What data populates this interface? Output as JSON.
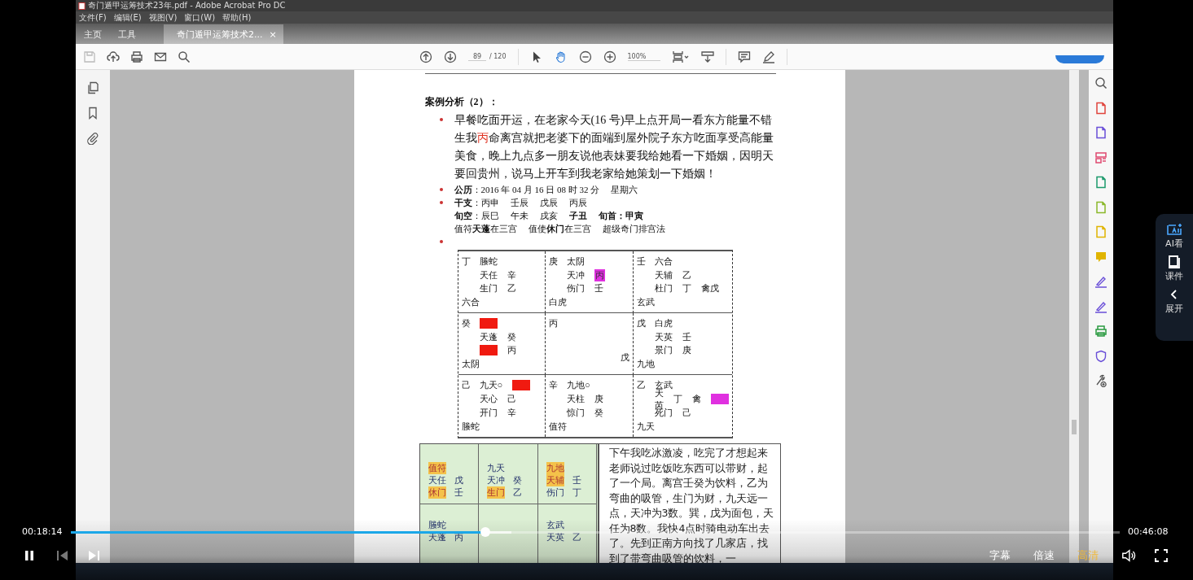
{
  "app": {
    "title": "奇门遁甲运筹技术23年.pdf - Adobe Acrobat Pro DC",
    "menus": [
      "文件(F)",
      "编辑(E)",
      "视图(V)",
      "窗口(W)",
      "帮助(H)"
    ],
    "tabs": [
      {
        "label": "主页",
        "selected": false
      },
      {
        "label": "工具",
        "selected": false
      },
      {
        "label": "奇门遁甲运筹技术2...",
        "selected": true,
        "close": "×"
      }
    ],
    "toolbar": {
      "page": "89",
      "page_count": "/ 120",
      "zoom": "100%"
    }
  },
  "document": {
    "heading": "案例分析（2）：",
    "story": [
      {
        "text": "早餐吃面开运，在老家今天(16 号)早上点开局一看东方能量不错生我",
        "red": false
      },
      {
        "text": "丙",
        "red": true
      },
      {
        "text": "命离宫就把老婆下的面端到屋外院子东方吃面享受高能量美食，晚上九点多一朋友说他表妹要我给她看一下婚姻，因明天要回贵州，说马上开车到我老家给她策划一下婚姻！",
        "red": false
      }
    ],
    "facts": [
      {
        "bullet": true,
        "items": [
          "**公历**：2016 年 04 月 16 日 08 时 32 分",
          "星期六"
        ]
      },
      {
        "bullet": true,
        "items": [
          "**干支**：丙申",
          "壬辰",
          "戊辰",
          "丙辰"
        ]
      },
      {
        "bullet": false,
        "items": [
          "**旬空**：辰巳",
          "午未",
          "戌亥",
          "**子丑**",
          "**旬首：甲寅**"
        ]
      },
      {
        "bullet": false,
        "items": [
          "值符**天蓬**在三宫",
          "值使**休门**在三宫",
          "超级奇门排宫法"
        ]
      }
    ],
    "grid": {
      "bullet": true,
      "cells": [
        {
          "kind": "palace",
          "lines": [
            [
              {
                "text": "丁"
              },
              {
                "text": "螣蛇"
              }
            ],
            [
              {
                "text": "天任"
              },
              {
                "text": "辛"
              }
            ],
            [
              {
                "text": "生门"
              },
              {
                "text": "乙"
              }
            ],
            [
              {
                "text": "六合"
              }
            ]
          ]
        },
        {
          "kind": "palace",
          "lines": [
            [
              {
                "text": "庚"
              },
              {
                "text": "太阴"
              }
            ],
            [
              {
                "text": "天冲"
              },
              {
                "text": "丙",
                "color": "#e030e0"
              }
            ],
            [
              {
                "text": "伤门"
              },
              {
                "text": "壬"
              }
            ],
            [
              {
                "text": "白虎"
              }
            ]
          ]
        },
        {
          "kind": "palace",
          "lines": [
            [
              {
                "text": "壬"
              },
              {
                "text": "六合"
              }
            ],
            [
              {
                "text": "天辅"
              },
              {
                "text": "乙"
              }
            ],
            [
              {
                "text": "杜门"
              },
              {
                "text": "丁"
              },
              {
                "text": "禽戊"
              }
            ],
            [
              {
                "text": "玄武"
              }
            ]
          ]
        },
        {
          "kind": "palace",
          "lines": [
            [
              {
                "text": "癸"
              },
              {
                "color": "#f01a10"
              }
            ],
            [
              {
                "text": "天蓬"
              },
              {
                "text": "癸"
              }
            ],
            [
              {
                "color": "#f01a10"
              },
              {
                "text": "丙"
              }
            ],
            [
              {
                "text": "太阴"
              }
            ]
          ]
        },
        {
          "kind": "center",
          "lines": [
            [
              {
                "text": "丙"
              }
            ],
            [
              {
                "text": "戊"
              }
            ]
          ]
        },
        {
          "kind": "palace",
          "lines": [
            [
              {
                "text": "戊"
              },
              {
                "text": "白虎"
              }
            ],
            [
              {
                "text": "天英"
              },
              {
                "text": "壬"
              }
            ],
            [
              {
                "text": "景门"
              },
              {
                "text": "庚"
              }
            ],
            [
              {
                "text": "九地"
              }
            ]
          ]
        },
        {
          "kind": "palace",
          "lines": [
            [
              {
                "text": "己"
              },
              {
                "text": "九天○"
              },
              {
                "color": "#f01a10"
              }
            ],
            [
              {
                "text": "天心"
              },
              {
                "text": "己"
              }
            ],
            [
              {
                "text": "开门"
              },
              {
                "text": "辛"
              }
            ],
            [
              {
                "text": "螣蛇"
              }
            ]
          ]
        },
        {
          "kind": "palace",
          "lines": [
            [
              {
                "text": "辛"
              },
              {
                "text": "九地○"
              }
            ],
            [
              {
                "text": "天柱"
              },
              {
                "text": "庚"
              }
            ],
            [
              {
                "text": "惊门"
              },
              {
                "text": "癸"
              }
            ],
            [
              {
                "text": "值符"
              }
            ]
          ]
        },
        {
          "kind": "palace",
          "lines": [
            [
              {
                "text": "乙"
              },
              {
                "text": "玄武"
              }
            ],
            [
              {
                "text": "天芮"
              },
              {
                "text": "丁"
              },
              {
                "text": "禽"
              },
              {
                "color": "#e030e0"
              }
            ],
            [
              {
                "text": "死门"
              },
              {
                "text": "己"
              }
            ],
            [
              {
                "text": "九天"
              }
            ]
          ]
        }
      ]
    },
    "chart_screenshot": [
      {
        "kind": "filled",
        "lines": [
          [
            {
              "text": "值符",
              "marked": true
            }
          ],
          [
            {
              "text": "天任",
              "marked": false
            },
            {
              "text": "戊",
              "marked": false
            }
          ],
          [
            {
              "text": "休门",
              "marked": true
            },
            {
              "text": "壬",
              "marked": false
            }
          ]
        ]
      },
      {
        "kind": "filled",
        "lines": [
          [
            {
              "text": "九天",
              "marked": false
            }
          ],
          [
            {
              "text": "天冲",
              "marked": false
            },
            {
              "text": "癸",
              "marked": false
            }
          ],
          [
            {
              "text": "生门",
              "marked": true
            },
            {
              "text": "乙",
              "marked": false
            }
          ]
        ]
      },
      {
        "kind": "filled",
        "lines": [
          [
            {
              "text": "九地",
              "marked": true
            }
          ],
          [
            {
              "text": "天辅",
              "marked": true
            },
            {
              "text": "壬",
              "marked": false
            }
          ],
          [
            {
              "text": "伤门",
              "marked": false
            },
            {
              "text": "丁",
              "marked": false
            }
          ]
        ]
      },
      {
        "kind": "filled",
        "lines": [
          [
            {
              "text": "螣蛇",
              "marked": false
            }
          ],
          [
            {
              "text": "天蓬",
              "marked": false
            },
            {
              "text": "丙",
              "marked": false
            }
          ]
        ]
      },
      {
        "kind": "blank"
      },
      {
        "kind": "filled",
        "lines": [
          [
            {
              "text": "玄武",
              "marked": false
            }
          ],
          [
            {
              "text": "天英",
              "marked": false
            },
            {
              "text": "乙",
              "marked": false
            }
          ]
        ]
      }
    ],
    "note": "下午我吃冰激凌，吃完了才想起来老师说过吃饭吃东西可以带财，起了一个局。离宫壬癸为饮料，乙为弯曲的吸管，生门为财，九天远一点，天冲为3数。巽，戊为面包，天任为8数。我快4点时骑电动车出去了。先到正南方向找了几家店，找到了带弯曲吸管的饮料，一"
  },
  "side_panel": [
    {
      "kind": "ai",
      "label": "AI看"
    },
    {
      "kind": "book",
      "label": "课件"
    },
    {
      "kind": "expand",
      "label": "展开"
    }
  ],
  "player": {
    "current_time": "00:18:14",
    "duration": "00:46:08",
    "playing": true,
    "progress": {
      "level": 0.395
    },
    "buffered": {
      "level": 0.42
    },
    "buttons": [
      {
        "label": "字幕",
        "selected": false
      },
      {
        "label": "倍速",
        "selected": false
      },
      {
        "label": "高清",
        "selected": true
      }
    ]
  }
}
